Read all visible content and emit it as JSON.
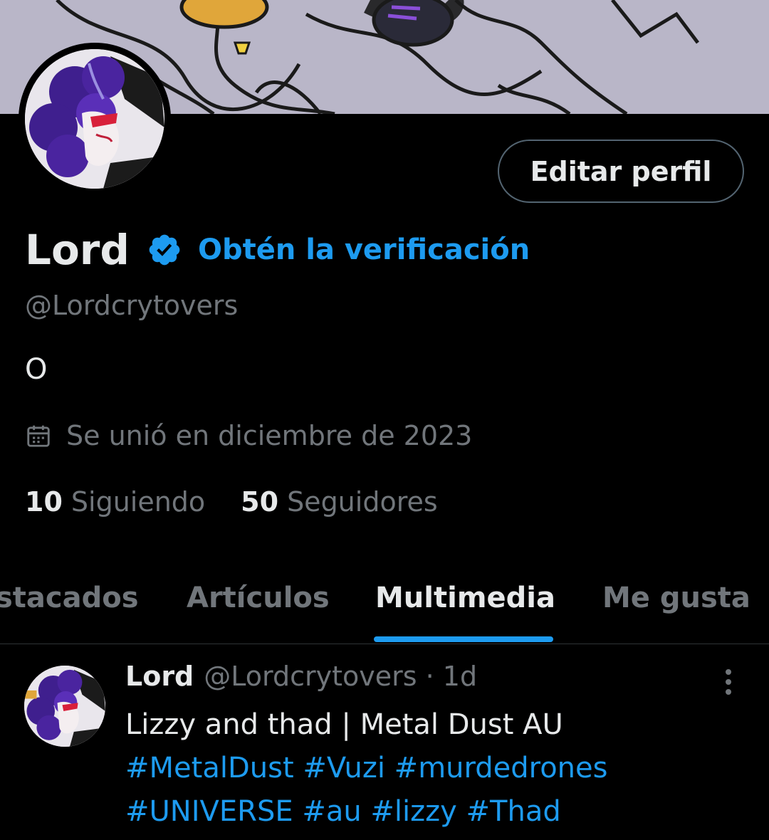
{
  "profile": {
    "name": "Lord",
    "get_verified_label": "Obtén la verificación",
    "handle": "@Lordcrytovers",
    "bio": "O",
    "joined": "Se unió en diciembre de 2023",
    "following_count": "10",
    "following_label": "Siguiendo",
    "followers_count": "50",
    "followers_label": "Seguidores",
    "edit_button_label": "Editar perfil"
  },
  "tabs": [
    {
      "label": "stacados"
    },
    {
      "label": "Artículos"
    },
    {
      "label": "Multimedia",
      "active": true
    },
    {
      "label": "Me gusta"
    }
  ],
  "post": {
    "author_name": "Lord",
    "author_meta": "@Lordcrytovers · 1d",
    "text": "Lizzy and thad | Metal Dust AU",
    "hashtag_lines": [
      "#MetalDust #Vuzi #murdedrones",
      "#UNIVERSE #au #lizzy #Thad"
    ]
  },
  "colors": {
    "accent": "#1d9bf0",
    "text_primary": "#e7e9ea",
    "text_secondary": "#71767b",
    "background": "#000000"
  },
  "icons": {
    "verified": "verified-badge-icon",
    "calendar": "calendar-icon",
    "more": "more-vertical-icon"
  }
}
